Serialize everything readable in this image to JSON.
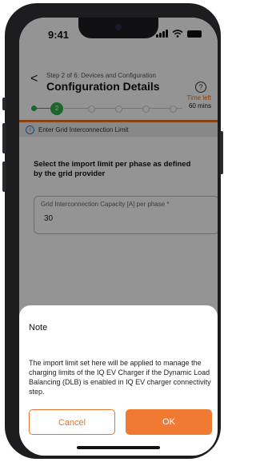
{
  "status": {
    "time": "9:41"
  },
  "header": {
    "step": "Step 2 of 6: Devices and Configuration",
    "title": "Configuration Details",
    "help_symbol": "?",
    "back_symbol": "<"
  },
  "progress": {
    "current_step": "2",
    "total_steps": 6,
    "time_left_label": "Time left",
    "time_left_value": "60 mins"
  },
  "info": {
    "text": "Enter Grid Interconnection Limit",
    "icon": "i"
  },
  "form": {
    "question": "Select the import limit per phase as defined by the grid provider",
    "field_label": "Grid Interconnection Capacity [A] per phase *",
    "field_value": "30"
  },
  "dialog": {
    "title": "Note",
    "body": "The import limit set here will be applied to manage the charging limits of the IQ EV Charger if the Dynamic Load Balancing (DLB) is enabled in IQ EV charger connectivity step.",
    "cancel_label": "Cancel",
    "ok_label": "OK"
  },
  "colors": {
    "accent": "#e8742b",
    "progress_active": "#2bb24c",
    "info": "#3b7bd6"
  },
  "icons": {
    "back": "chevron-left-icon",
    "help": "help-circle-icon",
    "info": "info-icon",
    "signal": "cell-signal-icon",
    "wifi": "wifi-icon",
    "battery": "battery-icon"
  }
}
